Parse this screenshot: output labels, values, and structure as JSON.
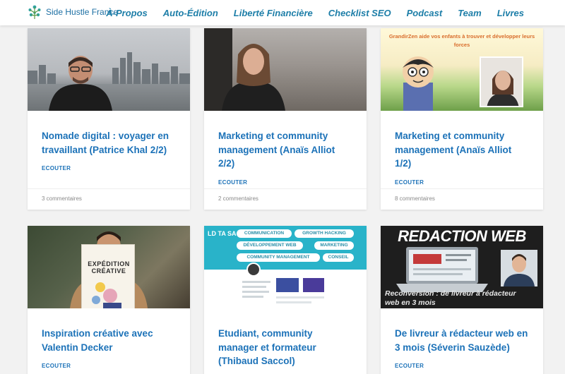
{
  "header": {
    "logo_text": "Side Hustle France",
    "nav": [
      {
        "label": "À-Propos"
      },
      {
        "label": "Auto-Édition"
      },
      {
        "label": "Liberté Financière"
      },
      {
        "label": "Checklist SEO"
      },
      {
        "label": "Podcast"
      },
      {
        "label": "Team"
      },
      {
        "label": "Livres"
      }
    ]
  },
  "posts": [
    {
      "title": "Nomade digital : voyager en travaillant (Patrice Khal 2/2)",
      "category": "ECOUTER",
      "comments": "3 commentaires"
    },
    {
      "title": "Marketing et community management (Anaïs Alliot 2/2)",
      "category": "ECOUTER",
      "comments": "2 commentaires"
    },
    {
      "title": "Marketing et community management (Anaïs Alliot 1/2)",
      "category": "ECOUTER",
      "comments": "8 commentaires",
      "image_text": "GrandirZen aide vos enfants à trouver et développer leurs forces"
    },
    {
      "title": "Inspiration créative avec Valentin Decker",
      "category": "ECOUTER",
      "comments": "",
      "image_text": "EXPÉDITION CRÉATIVE"
    },
    {
      "title": "Etudiant, community manager et formateur (Thibaud Saccol)",
      "category": "",
      "comments": "",
      "image_tags": [
        "COMMUNICATION",
        "GROWTH HACKING",
        "DÉVELOPPEMENT WEB",
        "MARKETING",
        "COMMUNITY MANAGEMENT",
        "CONSEIL"
      ],
      "image_brand": "LD TA SA"
    },
    {
      "title": "De livreur à rédacteur web en 3 mois (Séverin Sauzède)",
      "category": "ECOUTER",
      "comments": "",
      "image_title": "REDACTION WEB",
      "image_text": "Reconversion : de livreur à rédacteur web en 3 mois"
    }
  ]
}
